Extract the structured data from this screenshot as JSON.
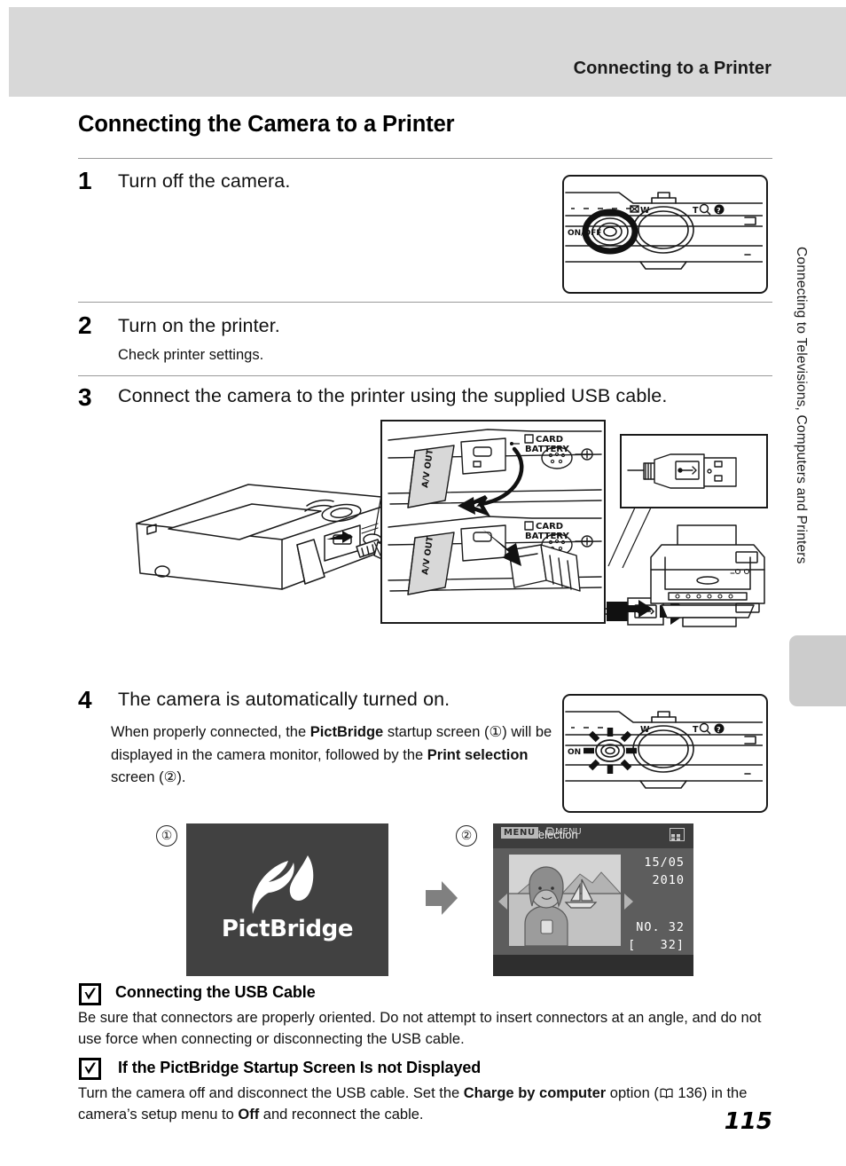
{
  "header": {
    "running_title": "Connecting to a Printer"
  },
  "side_tab": {
    "label": "Connecting to Televisions, Computers and Printers"
  },
  "section": {
    "heading": "Connecting the Camera to a Printer"
  },
  "steps": [
    {
      "number": "1",
      "title": "Turn off the camera.",
      "body": ""
    },
    {
      "number": "2",
      "title": "Turn on the printer.",
      "body": "Check printer settings."
    },
    {
      "number": "3",
      "title": "Connect the camera to the printer using the supplied USB cable.",
      "body": ""
    },
    {
      "number": "4",
      "title": "The camera is automatically turned on.",
      "body_html": "When properly connected, the <b>PictBridge</b> startup screen (①) will be displayed in the camera monitor, followed by the <b>Print selection</b> screen (②)."
    }
  ],
  "figures": {
    "callout_1": "①",
    "callout_2": "②",
    "pictbridge_screen": {
      "wordmark": "PictBridge",
      "background": "#414141"
    },
    "print_selection_screen": {
      "title": "Print selection",
      "date_line1": "15/05",
      "date_line2": "2010",
      "number_line1": "NO. 32",
      "number_line2": "[   32]",
      "menu_badge": "MENU",
      "menu_separator": ":",
      "menu_action": "MENU",
      "grid_icon": "thumbnail-grid-icon",
      "background": "#5d5d5d",
      "titlebar_background": "#3d3d3d"
    },
    "camera_labels": {
      "power_off": "ON/OFF",
      "power_on": "ON",
      "zoom_wide": "W",
      "zoom_tele": "T"
    },
    "port_cover_label": "A/V OUT",
    "port_labels_line1": "CARD",
    "port_labels_line2": "BATTERY"
  },
  "notes": [
    {
      "icon": "caution-check-icon",
      "heading": "Connecting the USB Cable",
      "body_html": "Be sure that connectors are properly oriented. Do not attempt to insert connectors at an angle, and do not use force when connecting or disconnecting the USB cable."
    },
    {
      "icon": "caution-check-icon",
      "heading": "If the PictBridge Startup Screen Is not Displayed",
      "body_html": "Turn the camera off and disconnect the USB cable. Set the <b>Charge by computer</b> option (<span class=\"book-ref\"></span> 136) in the camera’s setup menu to <b>Off</b> and reconnect the cable."
    }
  ],
  "footer": {
    "page_number": "115"
  },
  "colors": {
    "header_gray": "#d8d8d8",
    "tab_gray": "#cccccc",
    "rule_gray": "#9a9a9a",
    "screen_dark": "#414141",
    "screen_mid": "#5d5d5d",
    "arrow_gray": "#808080"
  }
}
